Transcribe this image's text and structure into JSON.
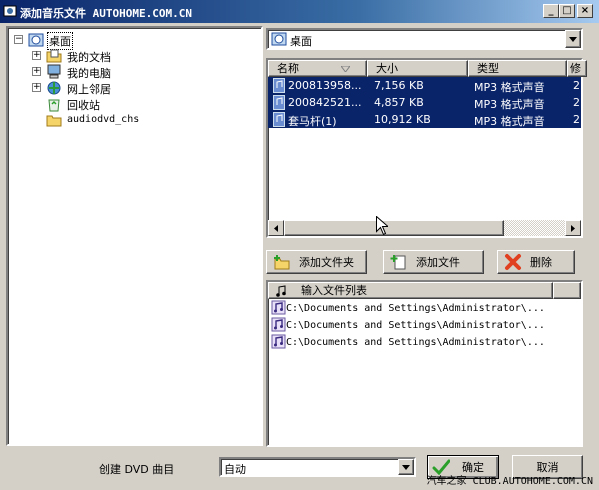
{
  "window": {
    "title": "添加音乐文件 AUTOHOME.COM.CN",
    "controls": {
      "minimize": "_",
      "maximize": "□",
      "close": "×"
    }
  },
  "tree": {
    "items": [
      {
        "label": "桌面",
        "icon": "desktop-icon",
        "expander": "−",
        "selected": true
      },
      {
        "label": "我的文档",
        "icon": "folder-documents-icon",
        "expander": "+"
      },
      {
        "label": "我的电脑",
        "icon": "computer-icon",
        "expander": "+"
      },
      {
        "label": "网上邻居",
        "icon": "network-icon",
        "expander": "+"
      },
      {
        "label": "回收站",
        "icon": "recycle-bin-icon",
        "expander": ""
      },
      {
        "label": "audiodvd_chs",
        "icon": "folder-icon",
        "expander": ""
      }
    ]
  },
  "location": {
    "value": "桌面"
  },
  "file_list": {
    "columns": [
      "名称",
      "大小",
      "类型",
      "修"
    ],
    "rows": [
      {
        "name": "200813958...",
        "size": "7,156 KB",
        "type": "MP3 格式声音",
        "extra": "2"
      },
      {
        "name": "200842521...",
        "size": "4,857 KB",
        "type": "MP3 格式声音",
        "extra": "2"
      },
      {
        "name": "套马杆(1)",
        "size": "10,912 KB",
        "type": "MP3 格式声音",
        "extra": "2"
      }
    ]
  },
  "buttons": {
    "add_folder": "添加文件夹",
    "add_file": "添加文件",
    "delete": "删除",
    "ok": "确定",
    "cancel": "取消"
  },
  "input_list": {
    "header": "输入文件列表",
    "rows": [
      "C:\\Documents and Settings\\Administrator\\...",
      "C:\\Documents and Settings\\Administrator\\...",
      "C:\\Documents and Settings\\Administrator\\..."
    ]
  },
  "footer": {
    "label": "创建 DVD 曲目",
    "mode_value": "自动",
    "watermark": "汽车之家 CLUB.AUTOHOME.COM.CN"
  },
  "colors": {
    "title_bar": "#0a246a",
    "selection": "#0a246a",
    "face": "#d4d0c8"
  }
}
